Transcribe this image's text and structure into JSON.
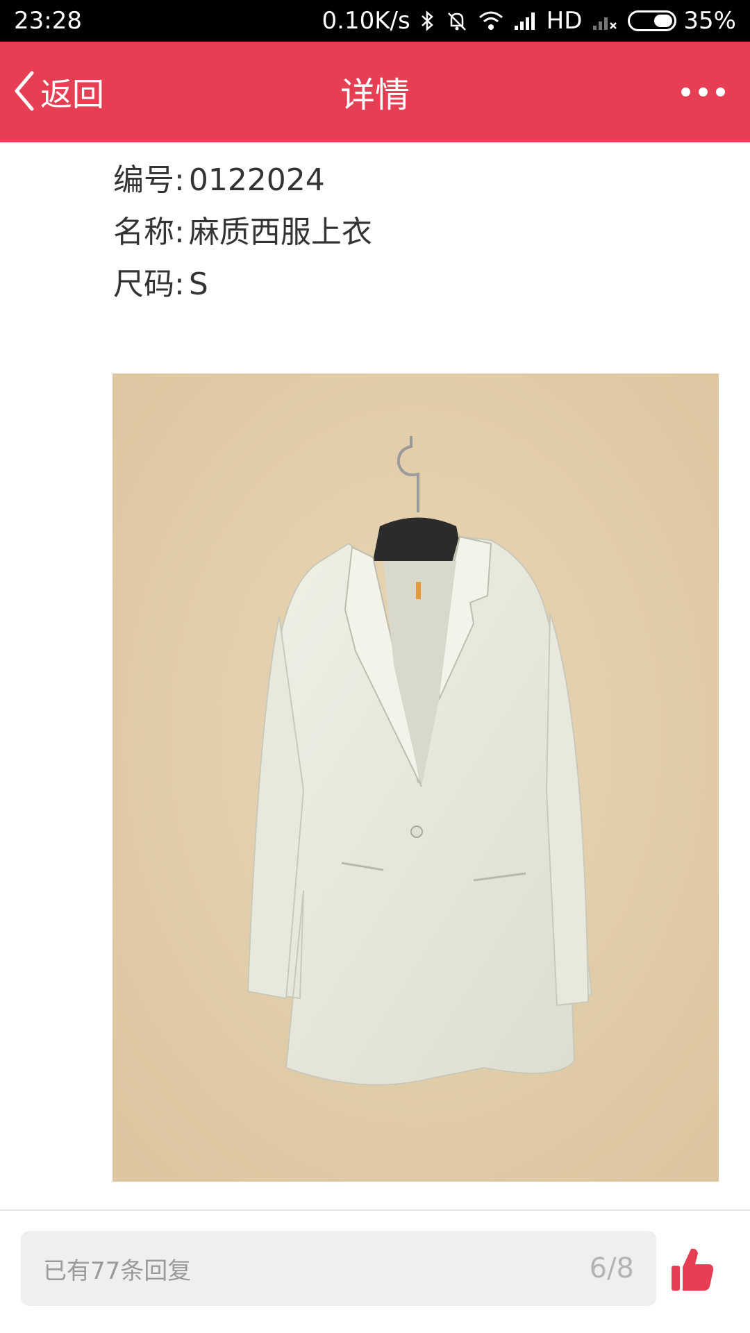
{
  "status_bar": {
    "time": "23:28",
    "net_speed": "0.10K/s",
    "network_type": "HD",
    "battery": "35%"
  },
  "nav": {
    "back_label": "返回",
    "title": "详情"
  },
  "product": {
    "code_label": "编号:",
    "code": "0122024",
    "name_label": "名称:",
    "name": "麻质西服上衣",
    "size_label": "尺码:",
    "size": "S"
  },
  "footer": {
    "reply_text": "已有77条回复",
    "page_indicator": "6/8"
  },
  "colors": {
    "accent": "#e63e52",
    "text": "#333333",
    "muted": "#9a9a9a"
  }
}
